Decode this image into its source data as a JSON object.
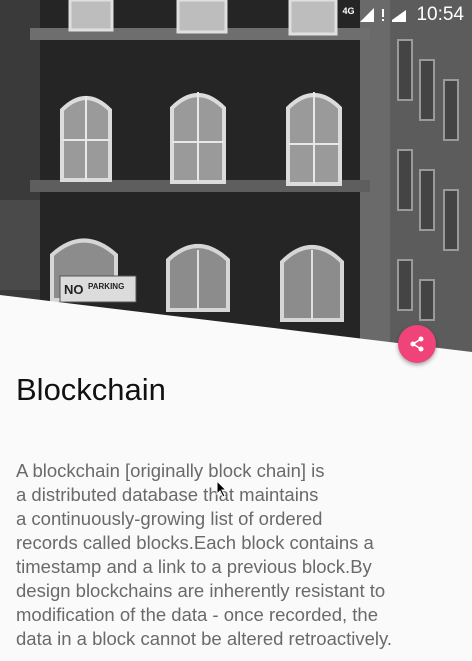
{
  "status_bar": {
    "network": "4G",
    "time": "10:54"
  },
  "icons": {
    "signal": "signal-icon",
    "alert": "alert-icon",
    "battery": "battery-icon",
    "share": "share-icon"
  },
  "colors": {
    "fab": "#f0437a",
    "title": "#111111",
    "body": "#6a6a6a"
  },
  "article": {
    "title": "Blockchain",
    "body_lines": [
      "A blockchain [originally block chain] is",
      "a distributed database that maintains",
      "a continuously-growing list of ordered",
      "records called blocks.Each block contains a",
      "timestamp and a link to a previous block.By",
      "design blockchains are inherently resistant to",
      "modification of the data - once recorded, the",
      "data in a block cannot be altered retroactively."
    ]
  },
  "hero_sign": {
    "no": "NO",
    "parking": "PARKING"
  }
}
